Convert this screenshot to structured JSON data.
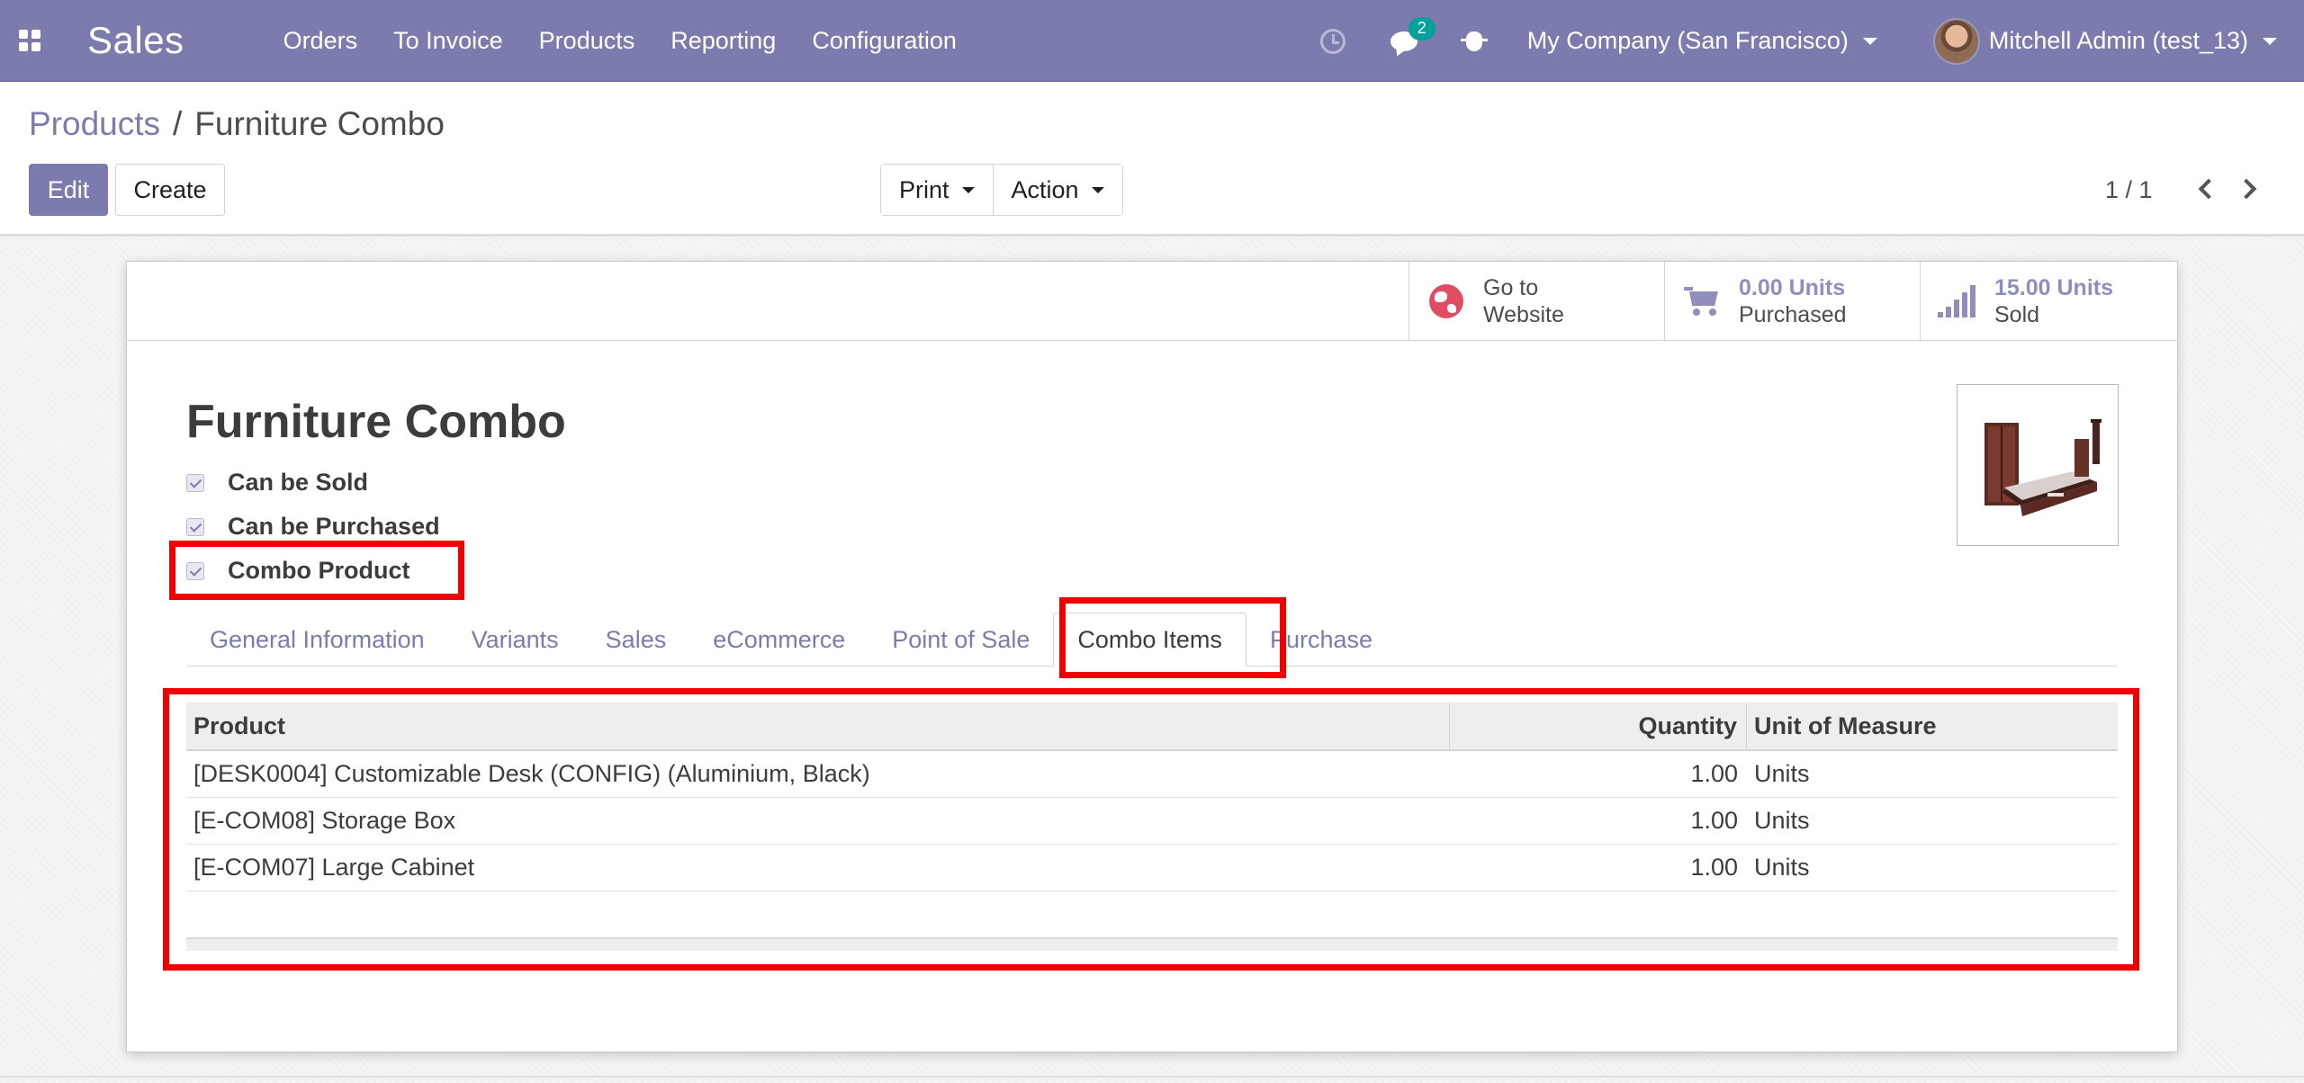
{
  "navbar": {
    "brand": "Sales",
    "menu": [
      "Orders",
      "To Invoice",
      "Products",
      "Reporting",
      "Configuration"
    ],
    "messages_count": "2",
    "company": "My Company (San Francisco)",
    "user": "Mitchell Admin (test_13)",
    "icons": [
      "apps-grid-icon",
      "clock-icon",
      "chat-icon",
      "bug-icon"
    ]
  },
  "control_panel": {
    "breadcrumb_parent": "Products",
    "breadcrumb_separator": "/",
    "breadcrumb_current": "Furniture Combo",
    "edit_label": "Edit",
    "create_label": "Create",
    "print_label": "Print",
    "action_label": "Action",
    "pager": "1 / 1"
  },
  "stat_buttons": {
    "website_line1": "Go to",
    "website_line2": "Website",
    "purchased_value": "0.00 Units",
    "purchased_label": "Purchased",
    "sold_value": "15.00 Units",
    "sold_label": "Sold"
  },
  "product": {
    "name": "Furniture Combo",
    "can_be_sold": "Can be Sold",
    "can_be_purchased": "Can be Purchased",
    "combo_product": "Combo Product"
  },
  "tabs": [
    "General Information",
    "Variants",
    "Sales",
    "eCommerce",
    "Point of Sale",
    "Combo Items",
    "Purchase"
  ],
  "active_tab": "Combo Items",
  "combo_table": {
    "headers": {
      "product": "Product",
      "quantity": "Quantity",
      "uom": "Unit of Measure"
    },
    "rows": [
      {
        "product": "[DESK0004] Customizable Desk (CONFIG) (Aluminium, Black)",
        "quantity": "1.00",
        "uom": "Units"
      },
      {
        "product": "[E-COM08] Storage Box",
        "quantity": "1.00",
        "uom": "Units"
      },
      {
        "product": "[E-COM07] Large Cabinet",
        "quantity": "1.00",
        "uom": "Units"
      }
    ]
  },
  "colors": {
    "primary": "#7c7bad",
    "highlight": "#f00000",
    "badge": "#00a09d",
    "globe": "#e04d63"
  }
}
